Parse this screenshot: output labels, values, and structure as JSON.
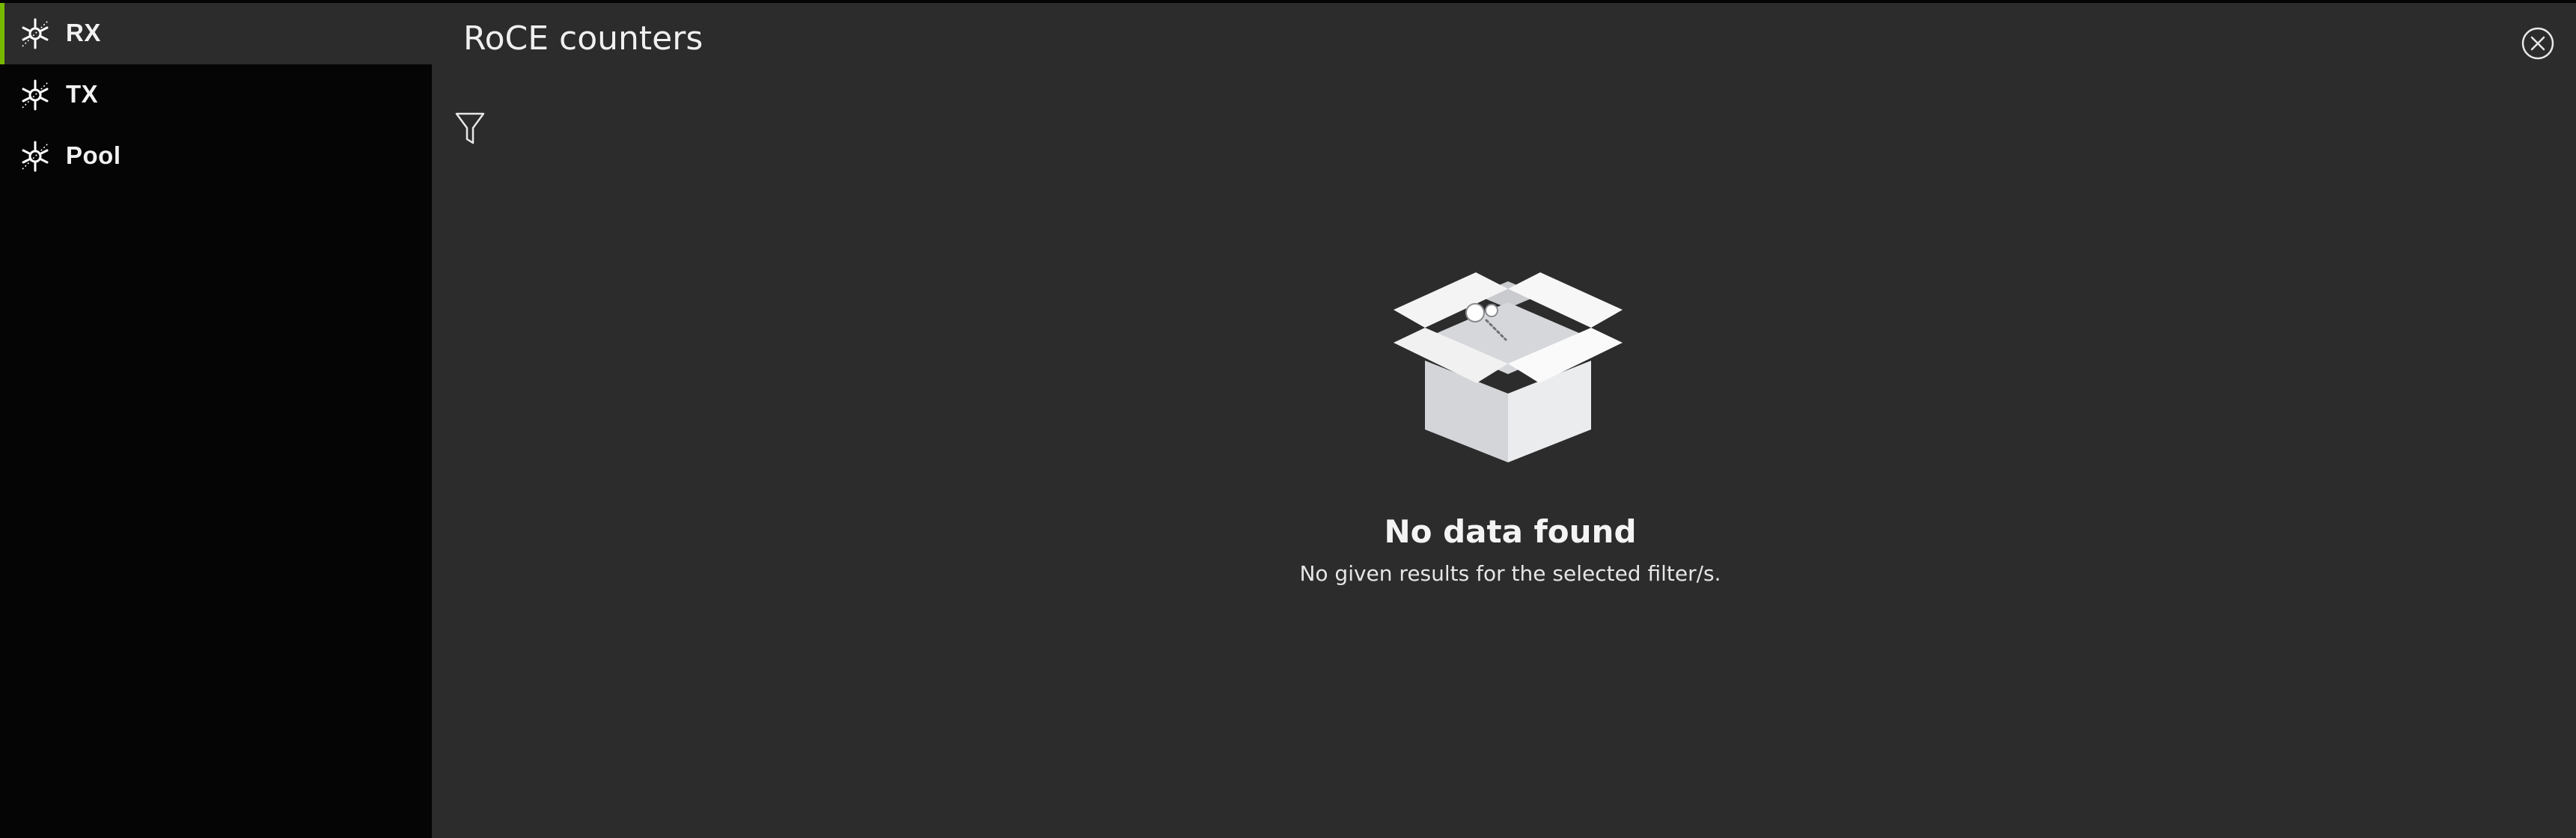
{
  "sidebar": {
    "items": [
      {
        "label": "RX",
        "icon": "counters-icon",
        "active": true
      },
      {
        "label": "TX",
        "icon": "counters-icon",
        "active": false
      },
      {
        "label": "Pool",
        "icon": "counters-icon",
        "active": false
      }
    ]
  },
  "panel": {
    "title": "RoCE counters",
    "close_icon": "close-circle-icon",
    "filter_icon": "filter-icon"
  },
  "empty_state": {
    "illustration": "empty-box-icon",
    "title": "No data found",
    "message": "No given results for the selected filter/s."
  },
  "colors": {
    "background": "#2c2c2c",
    "sidebar": "#050505",
    "accent": "#76b900",
    "text": "#f0f0f0"
  }
}
